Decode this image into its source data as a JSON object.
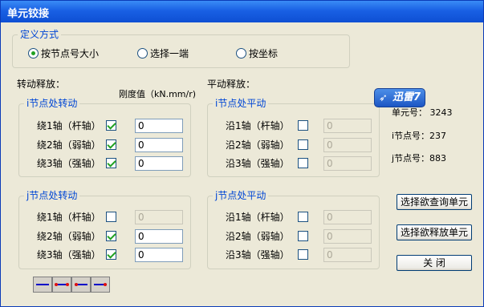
{
  "window": {
    "title": "单元铰接"
  },
  "define": {
    "group_label": "定义方式",
    "options": [
      {
        "label": "按节点号大小",
        "selected": true
      },
      {
        "label": "选择一端",
        "selected": false
      },
      {
        "label": "按坐标",
        "selected": false
      }
    ]
  },
  "rotation": {
    "title": "转动释放：",
    "stiffness_label": "刚度值（kN.mm/r)",
    "i_group": "i节点处转动",
    "j_group": "j节点处转动",
    "i_rows": [
      {
        "label": "绕1轴（杆轴）",
        "checked": true,
        "value": "0"
      },
      {
        "label": "绕2轴（弱轴）",
        "checked": true,
        "value": "0"
      },
      {
        "label": "绕3轴（强轴）",
        "checked": true,
        "value": "0"
      }
    ],
    "j_rows": [
      {
        "label": "绕1轴（杆轴）",
        "checked": false,
        "value": "0"
      },
      {
        "label": "绕2轴（弱轴）",
        "checked": true,
        "value": "0"
      },
      {
        "label": "绕3轴（强轴）",
        "checked": true,
        "value": "0"
      }
    ]
  },
  "translation": {
    "title": "平动释放：",
    "i_group": "i节点处平动",
    "j_group": "j节点处平动",
    "i_rows": [
      {
        "label": "沿1轴（杆轴）",
        "checked": false,
        "value": "0"
      },
      {
        "label": "沿2轴（弱轴）",
        "checked": false,
        "value": "0"
      },
      {
        "label": "沿3轴（强轴）",
        "checked": false,
        "value": "0"
      }
    ],
    "j_rows": [
      {
        "label": "沿1轴（杆轴）",
        "checked": false,
        "value": "0"
      },
      {
        "label": "沿2轴（弱轴）",
        "checked": false,
        "value": "0"
      },
      {
        "label": "沿3轴（强轴）",
        "checked": false,
        "value": "0"
      }
    ]
  },
  "info": {
    "element_no": "单元号：  3243",
    "i_node": "i节点号：237",
    "j_node": "j节点号：883"
  },
  "buttons": {
    "query": "选择欲查询单元",
    "release": "选择欲释放单元",
    "close": "关    闭"
  },
  "badge": {
    "text": "迅雷7"
  },
  "colors": {
    "title_bar": "#1960e4",
    "group_label": "#0046d5",
    "check": "#21a121",
    "icon_line": "#0000c8",
    "icon_node": "#e01010"
  }
}
